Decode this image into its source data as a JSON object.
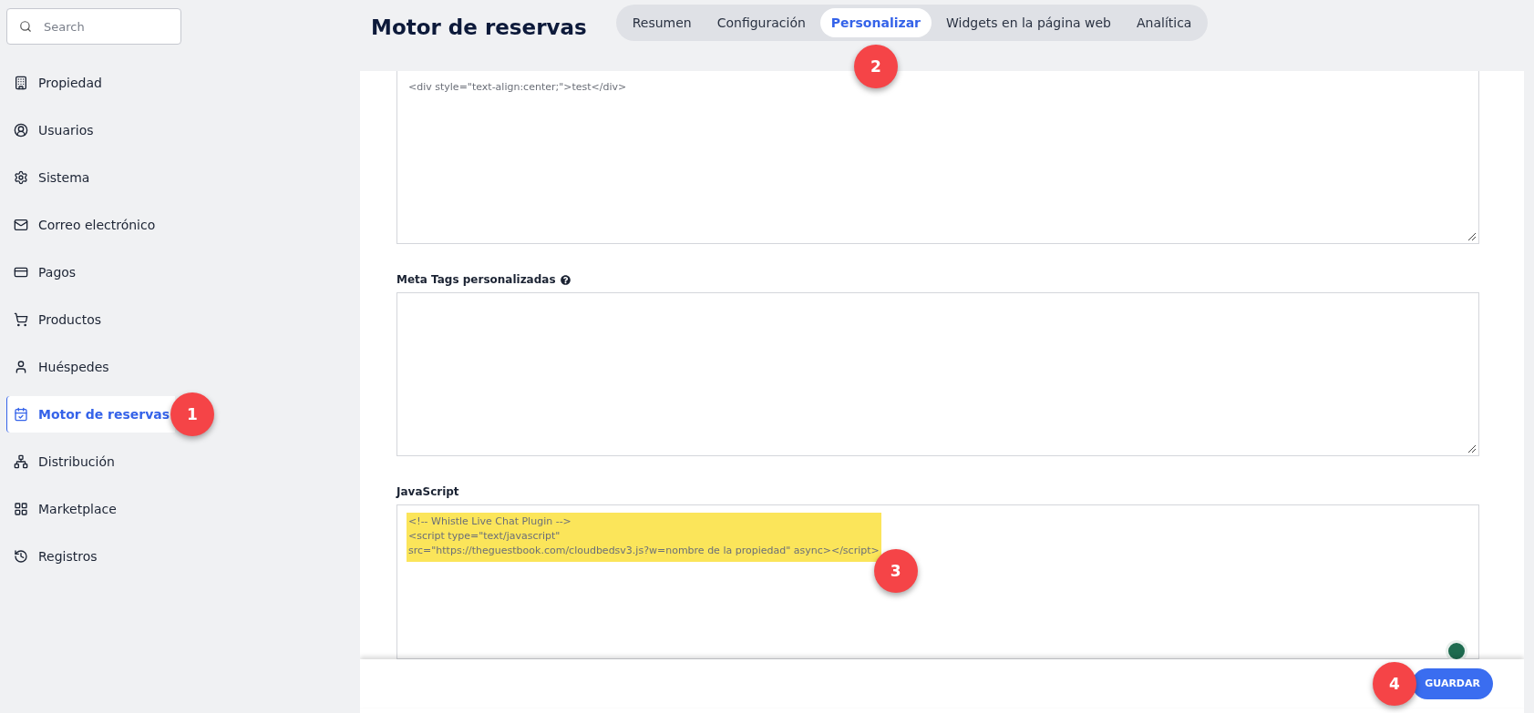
{
  "sidebar": {
    "search": {
      "placeholder": "Search"
    },
    "items": [
      {
        "label": "Propiedad",
        "selected": false
      },
      {
        "label": "Usuarios",
        "selected": false
      },
      {
        "label": "Sistema",
        "selected": false
      },
      {
        "label": "Correo electrónico",
        "selected": false
      },
      {
        "label": "Pagos",
        "selected": false
      },
      {
        "label": "Productos",
        "selected": false
      },
      {
        "label": "Huéspedes",
        "selected": false
      },
      {
        "label": "Motor de reservas",
        "selected": true,
        "marker": "1"
      },
      {
        "label": "Distribución",
        "selected": false
      },
      {
        "label": "Marketplace",
        "selected": false
      },
      {
        "label": "Registros",
        "selected": false
      }
    ]
  },
  "header": {
    "title": "Motor de reservas",
    "tabs": [
      {
        "label": "Resumen",
        "selected": false
      },
      {
        "label": "Configuración",
        "selected": false
      },
      {
        "label": "Personalizar",
        "selected": true,
        "marker": "2"
      },
      {
        "label": "Widgets en la página web",
        "selected": false
      },
      {
        "label": "Analítica",
        "selected": false
      }
    ]
  },
  "fields": [
    {
      "lines": [
        "<div style=\"text-align:center;\">test</div>"
      ]
    },
    {
      "label": "Meta Tags personalizadas",
      "help": true
    },
    {
      "label": "JavaScript",
      "lines": [
        "<!-- Whistle Live Chat Plugin -->",
        "<script type=\"text/javascript\"",
        "src=\"https://theguestbook.com/cloudbedsv3.js?w=nombre de la propiedad\" async></script>"
      ],
      "highlighted": true,
      "marker": "3"
    }
  ],
  "footer": {
    "save_button": "GUARDAR",
    "marker": "4"
  }
}
